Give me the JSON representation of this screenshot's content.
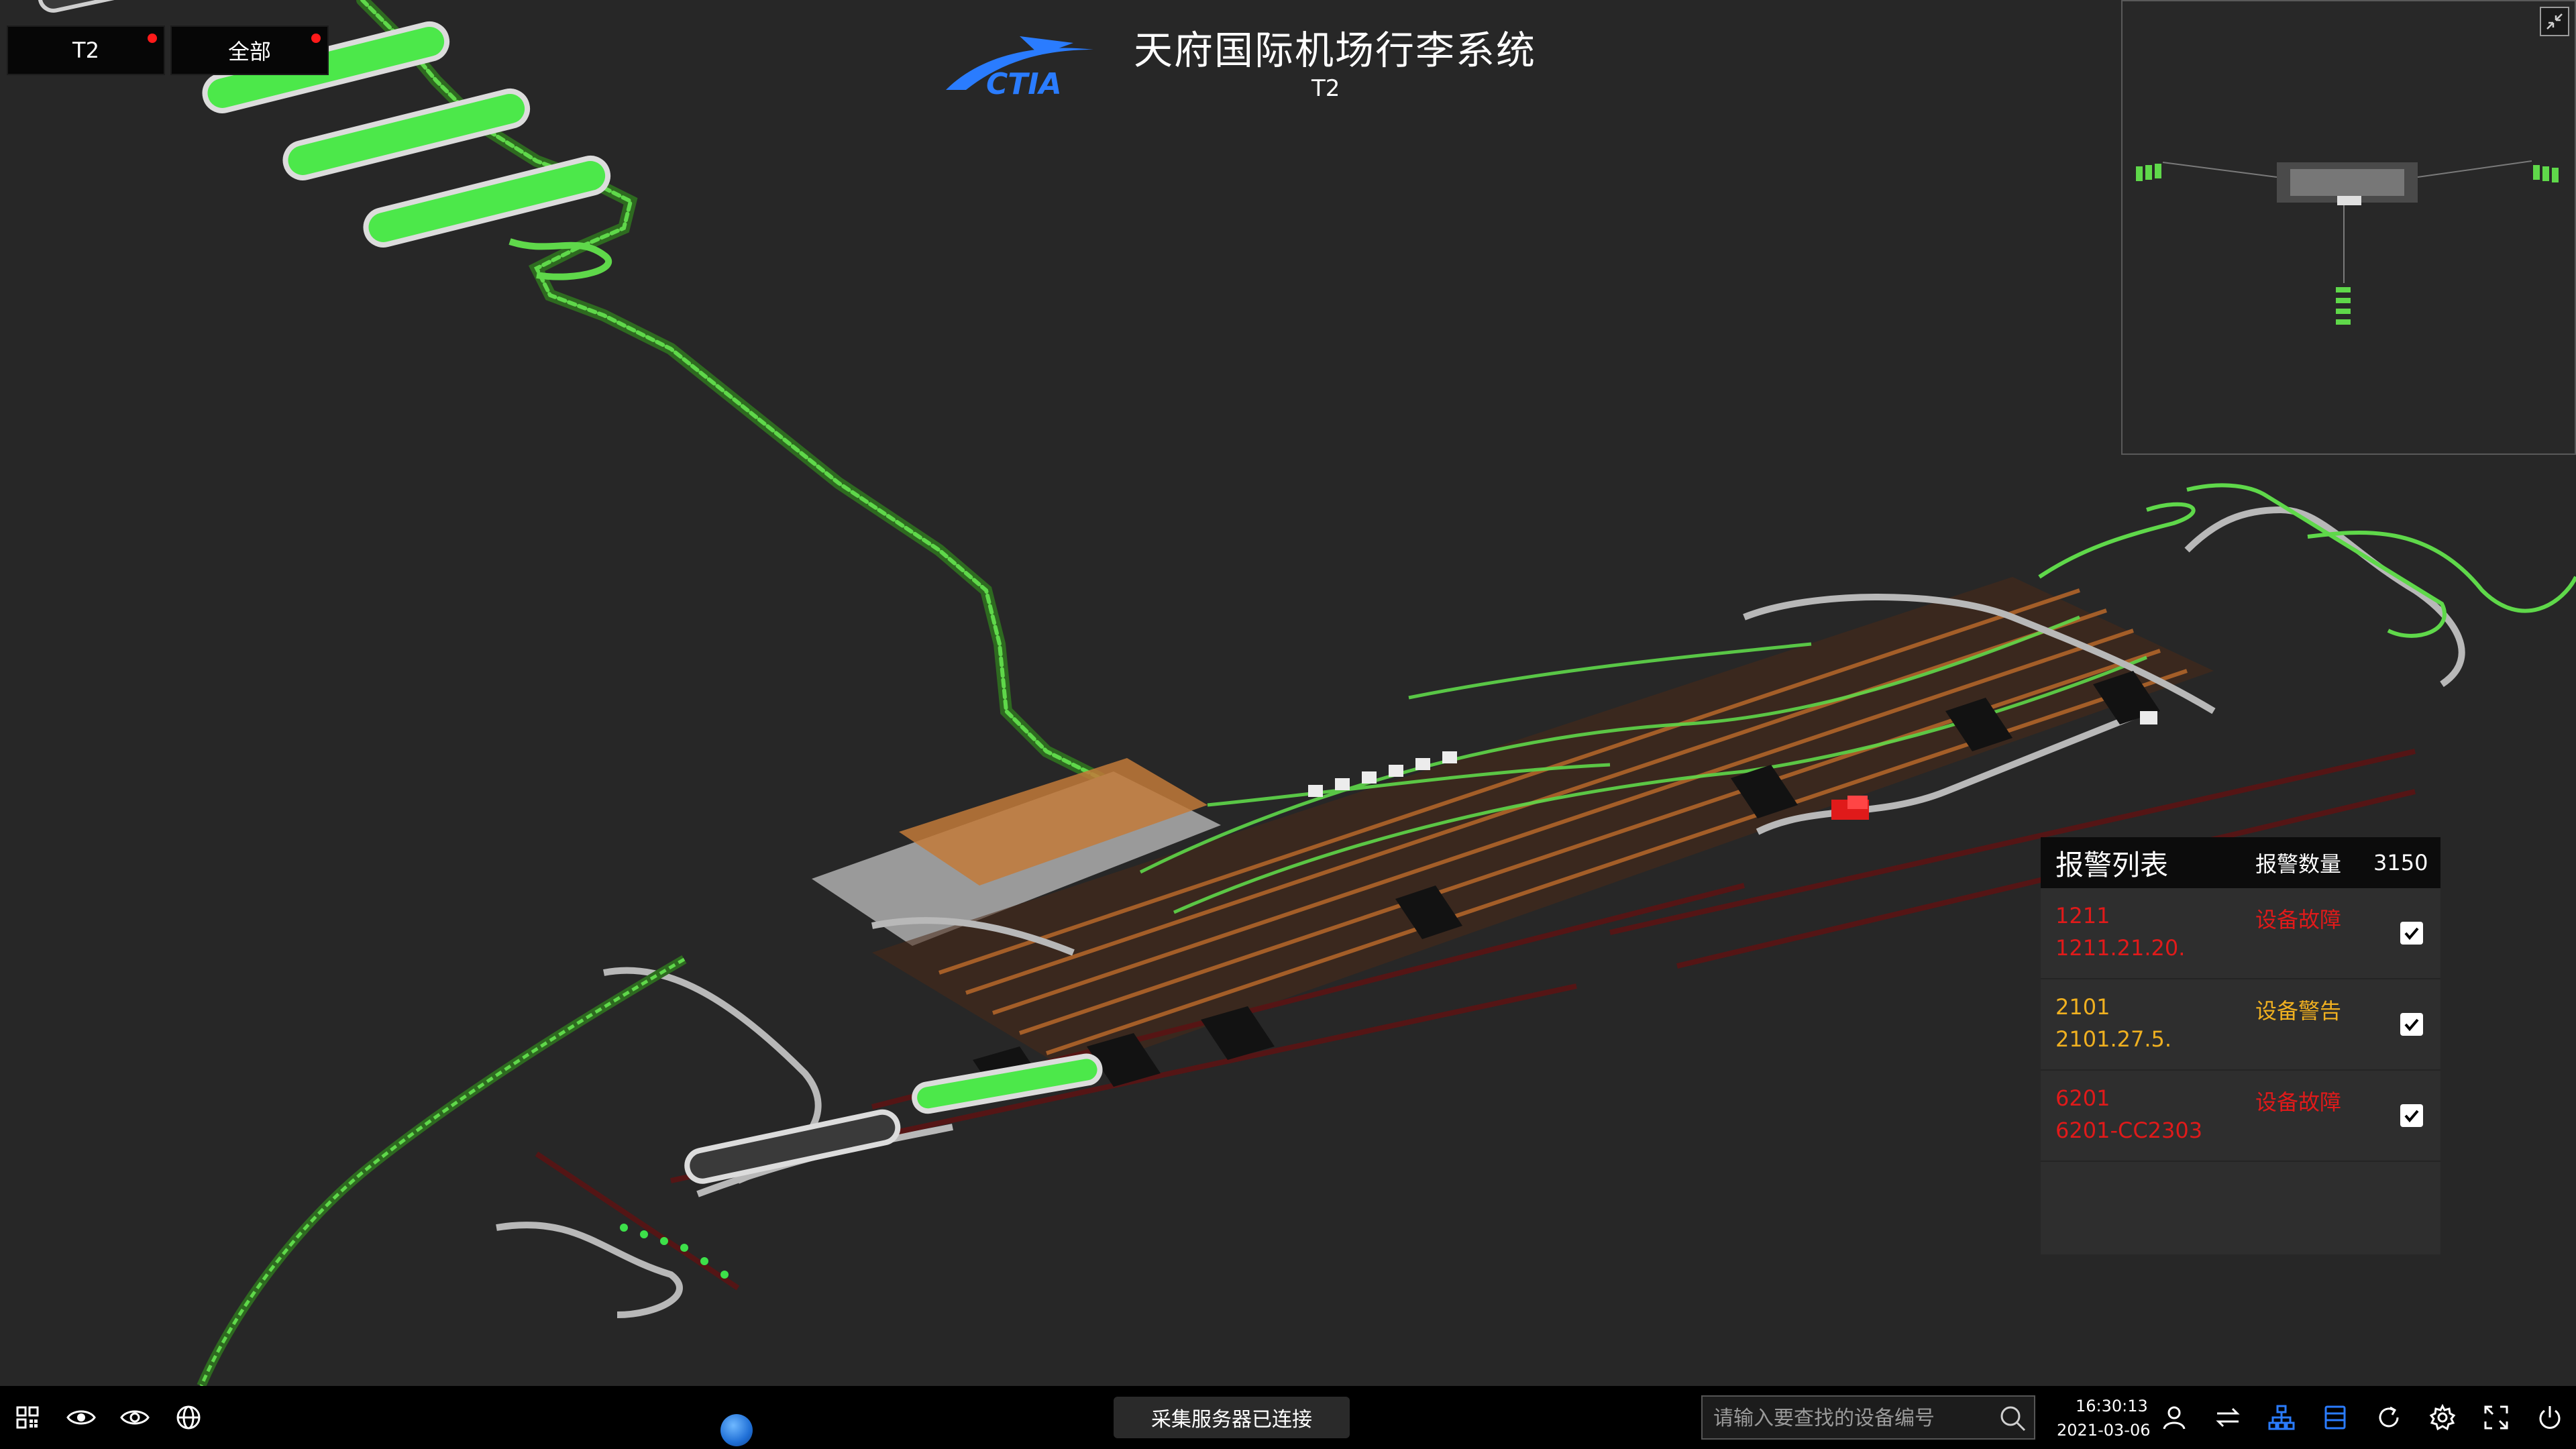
{
  "header": {
    "logo_text": "CTIA",
    "title": "天府国际机场行李系统",
    "subtitle": "T2"
  },
  "filters": [
    {
      "label": "T2",
      "has_alert": true
    },
    {
      "label": "全部",
      "has_alert": true
    }
  ],
  "alarm_panel": {
    "title": "报警列表",
    "count_label": "报警数量",
    "count": "3150",
    "items": [
      {
        "code": "1211",
        "device": "1211.21.20.",
        "type": "设备故障",
        "severity": "fault",
        "checked": true
      },
      {
        "code": "2101",
        "device": "2101.27.5.",
        "type": "设备警告",
        "severity": "warn",
        "checked": true
      },
      {
        "code": "6201",
        "device": "6201-CC2303",
        "type": "设备故障",
        "severity": "fault",
        "checked": true
      }
    ]
  },
  "toolbar": {
    "left_icons": [
      "grid-icon",
      "eye-icon",
      "eye-outline-icon",
      "globe-icon"
    ],
    "status_text": "采集服务器已连接",
    "search_placeholder": "请输入要查找的设备编号",
    "time": "16:30:13",
    "date": "2021-03-06",
    "right_icons": [
      "user-icon",
      "swap-icon",
      "network-icon",
      "list-icon",
      "refresh-icon",
      "settings-icon",
      "fullscreen-icon",
      "power-icon"
    ]
  },
  "colors": {
    "background": "#272727",
    "fault": "#e01a1a",
    "warning": "#f0b020",
    "conveyor_active": "#5fd84a",
    "conveyor_brown": "#b0642a",
    "conveyor_gray": "#b8b8b8",
    "accent_blue": "#2a7cff"
  }
}
